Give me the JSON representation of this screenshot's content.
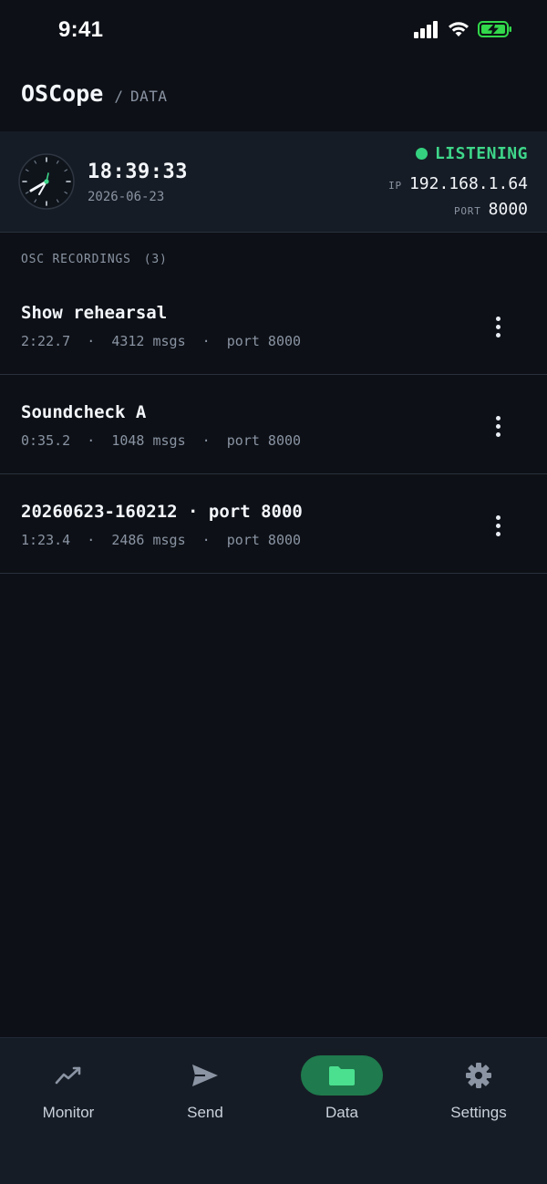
{
  "status_bar": {
    "time": "9:41",
    "battery_color": "#32d74b"
  },
  "header": {
    "app_title": "OSCope",
    "separator": "/",
    "crumb": "DATA"
  },
  "info_panel": {
    "time": "18:39:33",
    "date": "2026-06-23",
    "status": "LISTENING",
    "status_color": "#3ed68a",
    "ip_label": "IP",
    "ip_value": "192.168.1.64",
    "port_label": "PORT",
    "port_value": "8000"
  },
  "recordings": {
    "heading": "OSC RECORDINGS",
    "count": "(3)",
    "items": [
      {
        "title": "Show rehearsal",
        "meta": "2:22.7  ·  4312 msgs  ·  port 8000"
      },
      {
        "title": "Soundcheck A",
        "meta": "0:35.2  ·  1048 msgs  ·  port 8000"
      },
      {
        "title": "20260623-160212 · port 8000",
        "meta": "1:23.4  ·  2486 msgs  ·  port 8000"
      }
    ]
  },
  "tabs": [
    {
      "label": "Monitor",
      "icon": "trend-icon"
    },
    {
      "label": "Send",
      "icon": "send-icon"
    },
    {
      "label": "Data",
      "icon": "folder-icon",
      "active": true
    },
    {
      "label": "Settings",
      "icon": "gear-icon"
    }
  ],
  "colors": {
    "background": "#0d1016",
    "panel": "#161c25",
    "accent": "#1f7a4d",
    "accent_bright": "#3ed68a"
  }
}
